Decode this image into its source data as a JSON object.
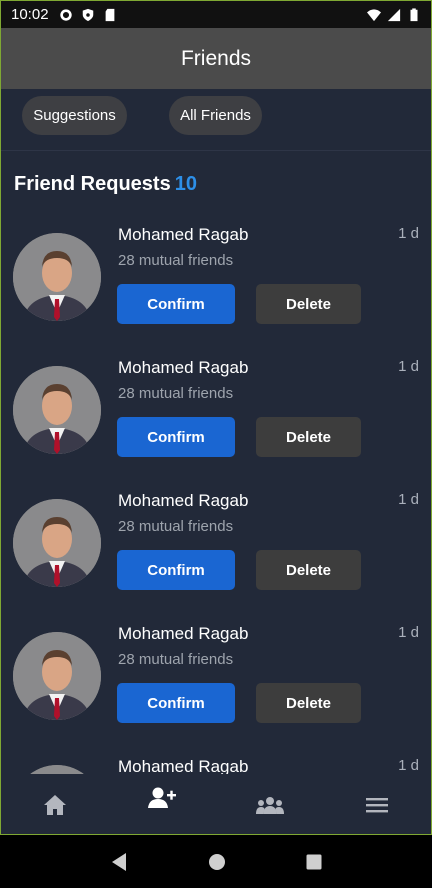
{
  "status_bar": {
    "time": "10:02"
  },
  "header": {
    "title": "Friends"
  },
  "filters": [
    {
      "label": "Suggestions"
    },
    {
      "label": "All Friends"
    }
  ],
  "section": {
    "title": "Friend Requests",
    "count": "10"
  },
  "requests": [
    {
      "name": "Mohamed Ragab",
      "time": "1 d",
      "mutual": "28 mutual friends",
      "confirm": "Confirm",
      "delete": "Delete"
    },
    {
      "name": "Mohamed Ragab",
      "time": "1 d",
      "mutual": "28 mutual friends",
      "confirm": "Confirm",
      "delete": "Delete"
    },
    {
      "name": "Mohamed Ragab",
      "time": "1 d",
      "mutual": "28 mutual friends",
      "confirm": "Confirm",
      "delete": "Delete"
    },
    {
      "name": "Mohamed Ragab",
      "time": "1 d",
      "mutual": "28 mutual friends",
      "confirm": "Confirm",
      "delete": "Delete"
    },
    {
      "name": "Mohamed Ragab",
      "time": "1 d"
    }
  ],
  "bottom_nav": [
    {
      "icon": "home-icon"
    },
    {
      "icon": "add-friend-icon",
      "active": true
    },
    {
      "icon": "groups-icon"
    },
    {
      "icon": "menu-icon"
    }
  ],
  "colors": {
    "accent": "#1a66d2",
    "count": "#2d8fe8",
    "background": "#222939",
    "header": "#4b4b4b"
  }
}
